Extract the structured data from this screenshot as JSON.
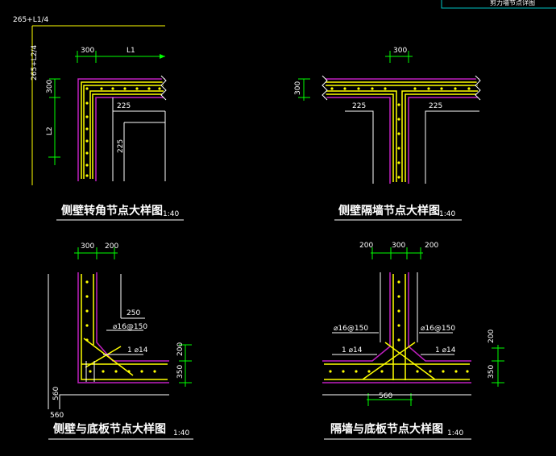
{
  "corner_tag": "剪力墙节点详图",
  "colors": {
    "background": "#000000",
    "wall": "#c020c0",
    "rebar": "#ffff00",
    "dim": "#00ff00",
    "text": "#ffffff",
    "axis": "#ffffff",
    "tag_box": "#00c0c0"
  },
  "d1": {
    "caption": "侧壁转角节点大样图",
    "scale": "1:40",
    "dims": {
      "top_overall": "265+L1/4",
      "left_overall": "265+L2/4",
      "w300": "300",
      "L1": "L1",
      "h300": "300",
      "L2": "L2",
      "d225a": "225",
      "d225b": "225"
    }
  },
  "d2": {
    "caption": "侧壁隔墙节点大样图",
    "scale": "1:40",
    "dims": {
      "w300": "300",
      "h300": "300",
      "d225a": "225",
      "d225b": "225"
    }
  },
  "d3": {
    "caption": "侧壁与底板节点大样图",
    "scale": "1:40",
    "dims": {
      "w300": "300",
      "w200": "200",
      "d250": "250",
      "bar1": "⌀16@150",
      "bar2": "1 ⌀14",
      "h200": "200",
      "h350": "350",
      "d560a": "560",
      "d560b": "560"
    }
  },
  "d4": {
    "caption": "隔墙与底板节点大样图",
    "scale": "1:40",
    "dims": {
      "w200a": "200",
      "w300": "300",
      "w200b": "200",
      "bar1l": "⌀16@150",
      "bar1r": "⌀16@150",
      "bar2l": "1 ⌀14",
      "bar2r": "1 ⌀14",
      "h200": "200",
      "h350": "350",
      "d560": "560"
    }
  }
}
